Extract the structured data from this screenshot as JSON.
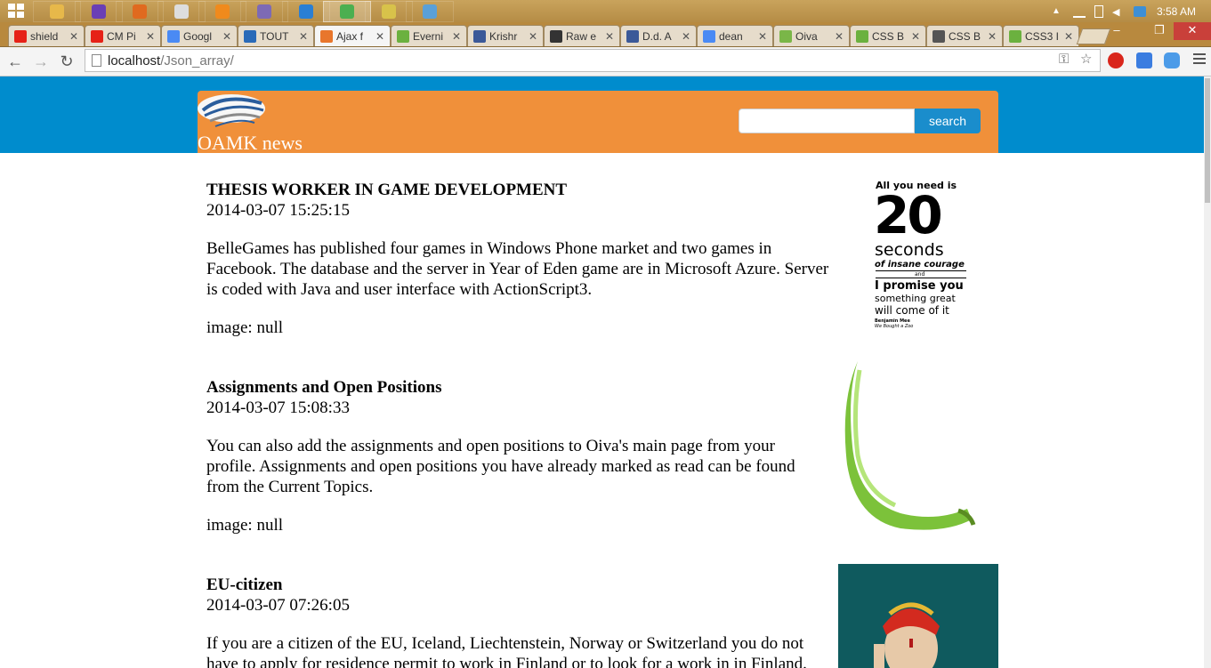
{
  "taskbar": {
    "apps": [
      {
        "icon": "file-explorer-icon",
        "color": "#e7b84a"
      },
      {
        "icon": "visual-studio-icon",
        "color": "#6a3fb5"
      },
      {
        "icon": "firefox-icon",
        "color": "#e06a1f"
      },
      {
        "icon": "calculator-icon",
        "color": "#dddddd"
      },
      {
        "icon": "vlc-icon",
        "color": "#f08a1c"
      },
      {
        "icon": "app-icon",
        "color": "#7d6ab5"
      },
      {
        "icon": "internet-explorer-icon",
        "color": "#2a7fd4"
      },
      {
        "icon": "chrome-icon",
        "color": "#4caf50"
      },
      {
        "icon": "app-icon",
        "color": "#d8c24a"
      },
      {
        "icon": "paint-icon",
        "color": "#5aa0d8"
      }
    ],
    "clock": "3:58 AM"
  },
  "browser": {
    "tabs": [
      {
        "title": "shield",
        "icon": "youtube-icon",
        "color": "#e62117"
      },
      {
        "title": "CM Pi",
        "icon": "youtube-icon",
        "color": "#e62117"
      },
      {
        "title": "Googl",
        "icon": "translate-icon",
        "color": "#4a8af4"
      },
      {
        "title": "TOUT",
        "icon": "app-icon",
        "color": "#2a6ab8"
      },
      {
        "title": "Ajax f",
        "icon": "app-icon",
        "color": "#e8762c",
        "active": true
      },
      {
        "title": "Everni",
        "icon": "evernote-icon",
        "color": "#6bb13f"
      },
      {
        "title": "Krishr",
        "icon": "facebook-icon",
        "color": "#3b5998"
      },
      {
        "title": "Raw e",
        "icon": "wwe-icon",
        "color": "#333333"
      },
      {
        "title": "D.d. A",
        "icon": "facebook-icon",
        "color": "#3b5998"
      },
      {
        "title": "dean",
        "icon": "google-icon",
        "color": "#4a8af4"
      },
      {
        "title": "Oiva",
        "icon": "leaf-icon",
        "color": "#7ab648"
      },
      {
        "title": "CSS B",
        "icon": "css-icon",
        "color": "#6bb13f"
      },
      {
        "title": "CSS B",
        "icon": "css-icon",
        "color": "#555555"
      },
      {
        "title": "CSS3 I",
        "icon": "css-icon",
        "color": "#6bb13f"
      }
    ],
    "url_host": "localhost",
    "url_path": "/Json_array/"
  },
  "page": {
    "site_title": "OAMK news",
    "search_button": "search",
    "search_value": "",
    "banner_color": "#008ccd",
    "header_color": "#f0903a",
    "articles": [
      {
        "title": "THESIS WORKER IN GAME DEVELOPMENT",
        "date": "2014-03-07 15:25:15",
        "body": "BelleGames has published four games in Windows Phone market and two games in Facebook. The database and the server in Year of Eden game are in Microsoft Azure. Server is coded with Java and user interface with ActionScript3.",
        "image": "image: null"
      },
      {
        "title": "Assignments and Open Positions",
        "date": "2014-03-07 15:08:33",
        "body": "You can also add the assignments and open positions to Oiva's main page from your profile. Assignments and open positions you have already marked as read can be found from the Current Topics.",
        "image": "image: null"
      },
      {
        "title": "EU-citizen",
        "date": "2014-03-07 07:26:05",
        "body": "If you are a citizen of the EU, Iceland, Liechtenstein, Norway or Switzerland you do not have to apply for residence permit to work in Finland or to look for a work in in Finland."
      }
    ],
    "poster": {
      "line1": "All you need is",
      "number": "20",
      "line2": "seconds",
      "line3": "of insane courage",
      "line4": "and",
      "line5": "I promise you",
      "line6": "something great",
      "line7": "will come of it",
      "credit1": "Benjamin Mee",
      "credit2": "We Bought a Zoo"
    }
  }
}
